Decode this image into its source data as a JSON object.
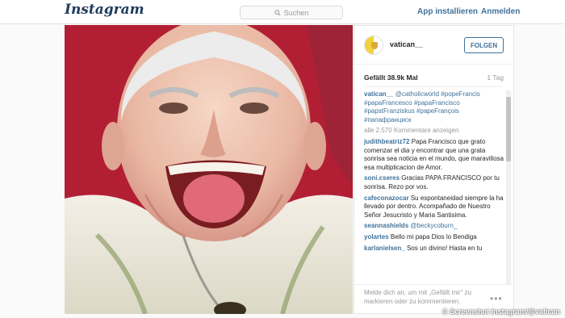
{
  "topbar": {
    "logo": "Instagram",
    "search_placeholder": "Suchen",
    "install_label": "App installieren",
    "login_label": "Anmelden"
  },
  "post": {
    "account": "vatican__",
    "follow_label": "FOLGEN",
    "likes": "Gefällt 38.9k Mal",
    "age": "1 Tag",
    "caption_user": "vatican__",
    "caption_text": "@catholicworld #popeFrancis #papaFrancesco #papaFrancisco #papstFranziskus #papeFrançois #папафранциск",
    "view_more": "alle 2.570 Kommentare anzeigen",
    "comments": [
      {
        "user": "judithbeatriz72",
        "text": "Papa Francisco que grato comenzar el dia y encontrar que una grata sonrisa sea noticia en el mundo, que maravillosa esa multiplicacion de Amor."
      },
      {
        "user": "soni.cseres",
        "text": "Gracias PAPA FRANCISCO por tu sonrisa. Rezo por vos."
      },
      {
        "user": "cafeconazocar",
        "text": "Su espontaneidad siempre la ha llevado por dentro. Acompañado de Nuestro Señor Jesucristo y Maria Santisima."
      },
      {
        "user": "seannashields",
        "text": "@beckycoburn_"
      },
      {
        "user": "yolartes",
        "text": "Bello mi papa Dios lo Bendiga"
      },
      {
        "user": "karlanielsen_",
        "text": "Sos un divino! Hasta en tu"
      }
    ],
    "footer_text": "Melde dich an, um mit „Gefällt mir“ zu markieren oder zu kommentieren.",
    "more_icon": "•••"
  },
  "credit": "© Screenshot Instagram/@vatican",
  "colors": {
    "accent": "#3f729b",
    "photo_background": "#c9253a"
  }
}
